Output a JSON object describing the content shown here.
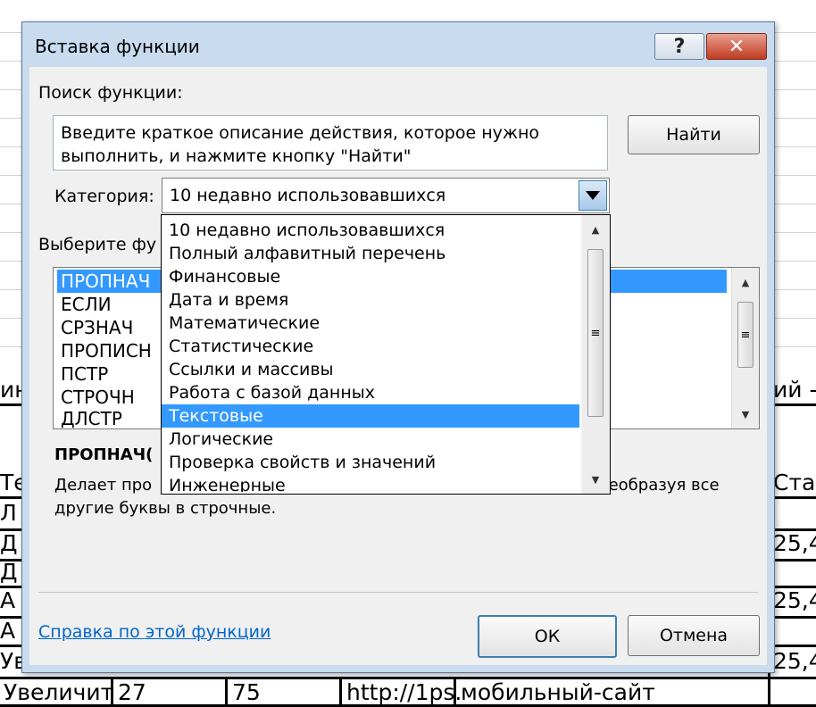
{
  "sheet": {
    "left_cells": [
      "ин",
      "Те",
      "Л",
      "Д",
      "Д",
      "А",
      "А",
      "Ув"
    ],
    "right_cells": [
      "ий -с",
      "Став",
      "25,4",
      "25,4",
      "25,4"
    ],
    "bottom_row": [
      "Увеличит",
      "27",
      "75",
      "http://1ps.",
      "мобильный-сайт"
    ]
  },
  "dialog": {
    "title": "Вставка функции",
    "help_button": "?",
    "close_button": "✕",
    "search_label": "Поиск функции:",
    "search_value": "Введите краткое описание действия, которое нужно выполнить, и нажмите кнопку \"Найти\"",
    "find_button": "Найти",
    "category_label": "Категория:",
    "category_value": "10 недавно использовавшихся",
    "select_function_label": "Выберите фу",
    "functions": [
      "ПРОПНАЧ",
      "ЕСЛИ",
      "СРЗНАЧ",
      "ПРОПИСН",
      "ПСТР",
      "СТРОЧН",
      "ДЛСТР"
    ],
    "selected_function": "ПРОПНАЧ",
    "desc_title": "ПРОПНАЧ(",
    "desc_line1_start": "Делает про",
    "desc_line1_end": "реобразуя все",
    "desc_line2": "другие буквы в строчные.",
    "help_link": "Справка по этой функции",
    "ok_button": "ОК",
    "cancel_button": "Отмена"
  },
  "dropdown": {
    "items": [
      "10 недавно использовавшихся",
      "Полный алфавитный перечень",
      "Финансовые",
      "Дата и время",
      "Математические",
      "Статистические",
      "Ссылки и массивы",
      "Работа с базой данных",
      "Текстовые",
      "Логические",
      "Проверка свойств и значений",
      "Инженерные"
    ],
    "selected": "Текстовые"
  },
  "icons": {
    "dropdown_arrow": "chevron-down-icon",
    "scroll_up": "scroll-up-icon",
    "scroll_down": "scroll-down-icon",
    "scroll_grip": "grip-icon"
  },
  "colors": {
    "selection": "#3399ff",
    "dialog_frame": "#c9dbee",
    "close_button": "#c23b22",
    "link": "#0066cc"
  }
}
